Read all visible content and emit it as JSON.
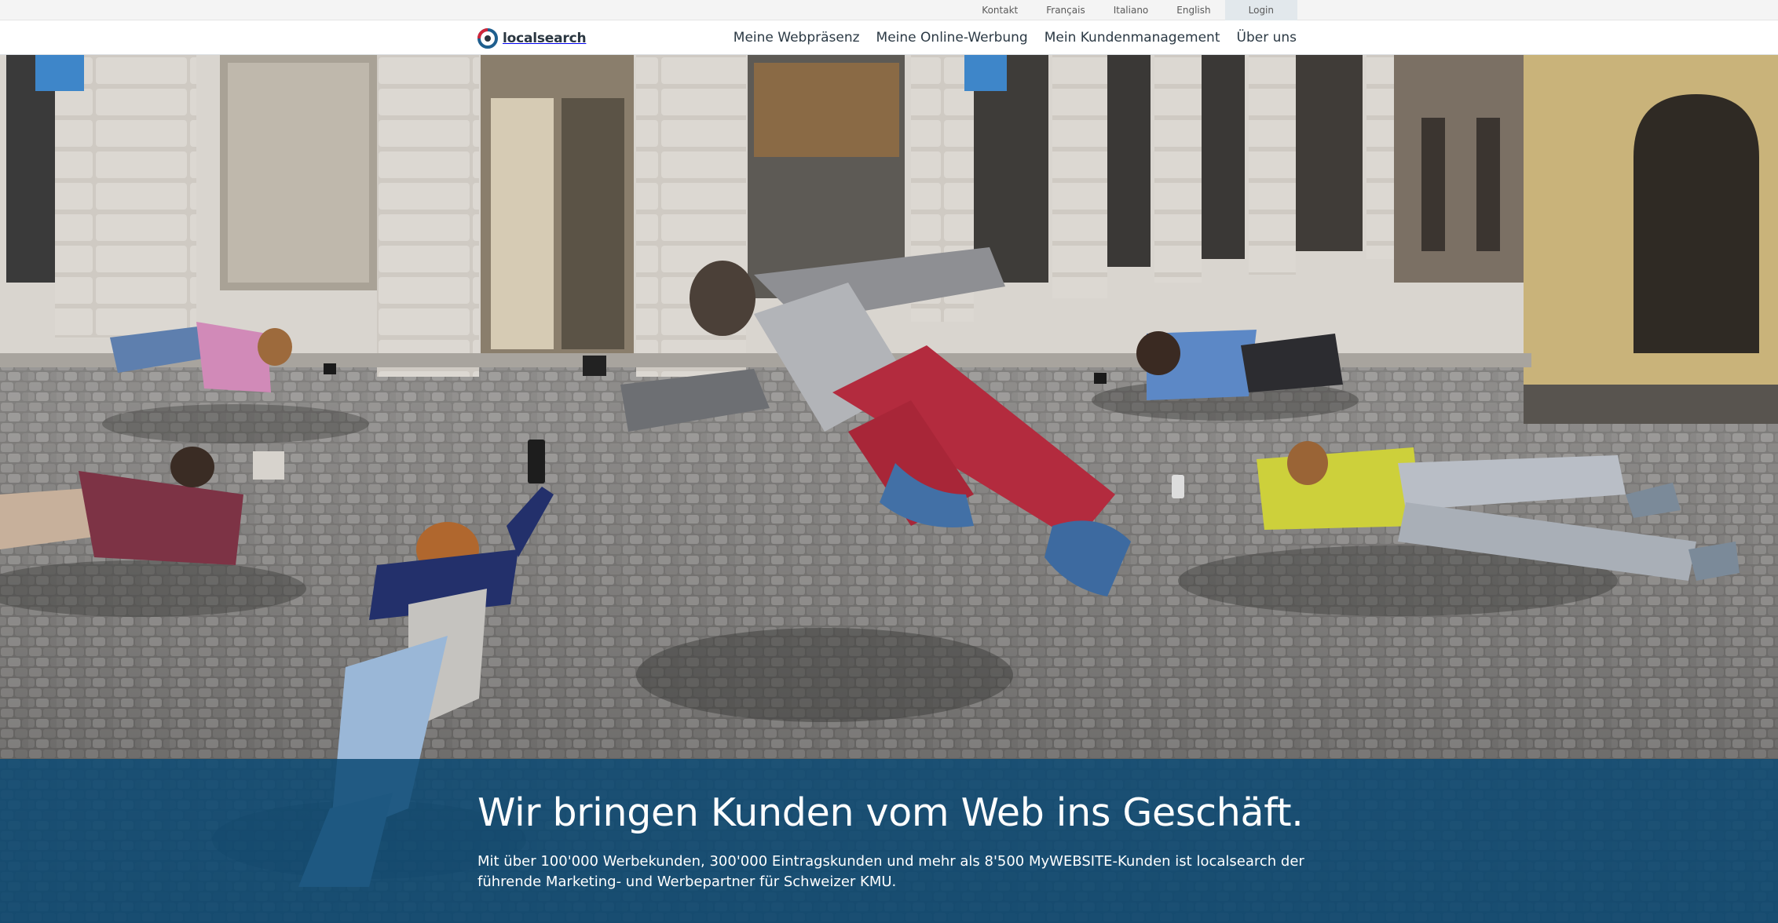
{
  "top_links": {
    "kontakt": "Kontakt",
    "francais": "Français",
    "italiano": "Italiano",
    "english": "English",
    "login": "Login"
  },
  "logo": {
    "text": "localsearch",
    "icon": "localsearch-logo-icon"
  },
  "main_nav": {
    "webpraesenz": "Meine Webpräsenz",
    "online_werbung": "Meine Online-Werbung",
    "kundenmanagement": "Mein Kundenmanagement",
    "ueber_uns": "Über uns"
  },
  "hero": {
    "headline": "Wir bringen Kunden vom Web ins Geschäft.",
    "text": "Mit über 100'000 Werbekunden, 300'000 Eintragskunden und mehr als 8'500 MyWEBSITE-Kunden ist localsearch der führende Marketing- und Werbepartner für Schweizer KMU."
  },
  "colors": {
    "banner": "#0d4b75",
    "logo_ring_blue": "#1f5f8e",
    "logo_ring_red": "#d0263a"
  }
}
